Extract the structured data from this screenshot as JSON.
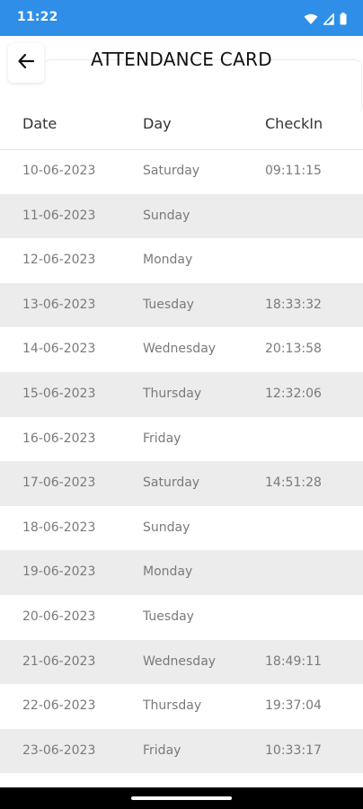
{
  "status_bar": {
    "time": "11:22",
    "icons": [
      "wifi-icon",
      "signal-icon",
      "battery-icon"
    ],
    "color": "#2f8fe8"
  },
  "header": {
    "title": "ATTENDANCE CARD",
    "back_icon": "arrow-left-icon"
  },
  "table": {
    "columns": [
      "Date",
      "Day",
      "CheckIn"
    ],
    "rows": [
      {
        "date": "10-06-2023",
        "day": "Saturday",
        "checkin": "09:11:15"
      },
      {
        "date": "11-06-2023",
        "day": "Sunday",
        "checkin": ""
      },
      {
        "date": "12-06-2023",
        "day": "Monday",
        "checkin": ""
      },
      {
        "date": "13-06-2023",
        "day": "Tuesday",
        "checkin": "18:33:32"
      },
      {
        "date": "14-06-2023",
        "day": "Wednesday",
        "checkin": "20:13:58"
      },
      {
        "date": "15-06-2023",
        "day": "Thursday",
        "checkin": "12:32:06"
      },
      {
        "date": "16-06-2023",
        "day": "Friday",
        "checkin": ""
      },
      {
        "date": "17-06-2023",
        "day": "Saturday",
        "checkin": "14:51:28"
      },
      {
        "date": "18-06-2023",
        "day": "Sunday",
        "checkin": ""
      },
      {
        "date": "19-06-2023",
        "day": "Monday",
        "checkin": ""
      },
      {
        "date": "20-06-2023",
        "day": "Tuesday",
        "checkin": ""
      },
      {
        "date": "21-06-2023",
        "day": "Wednesday",
        "checkin": "18:49:11"
      },
      {
        "date": "22-06-2023",
        "day": "Thursday",
        "checkin": "19:37:04"
      },
      {
        "date": "23-06-2023",
        "day": "Friday",
        "checkin": "10:33:17"
      }
    ]
  }
}
